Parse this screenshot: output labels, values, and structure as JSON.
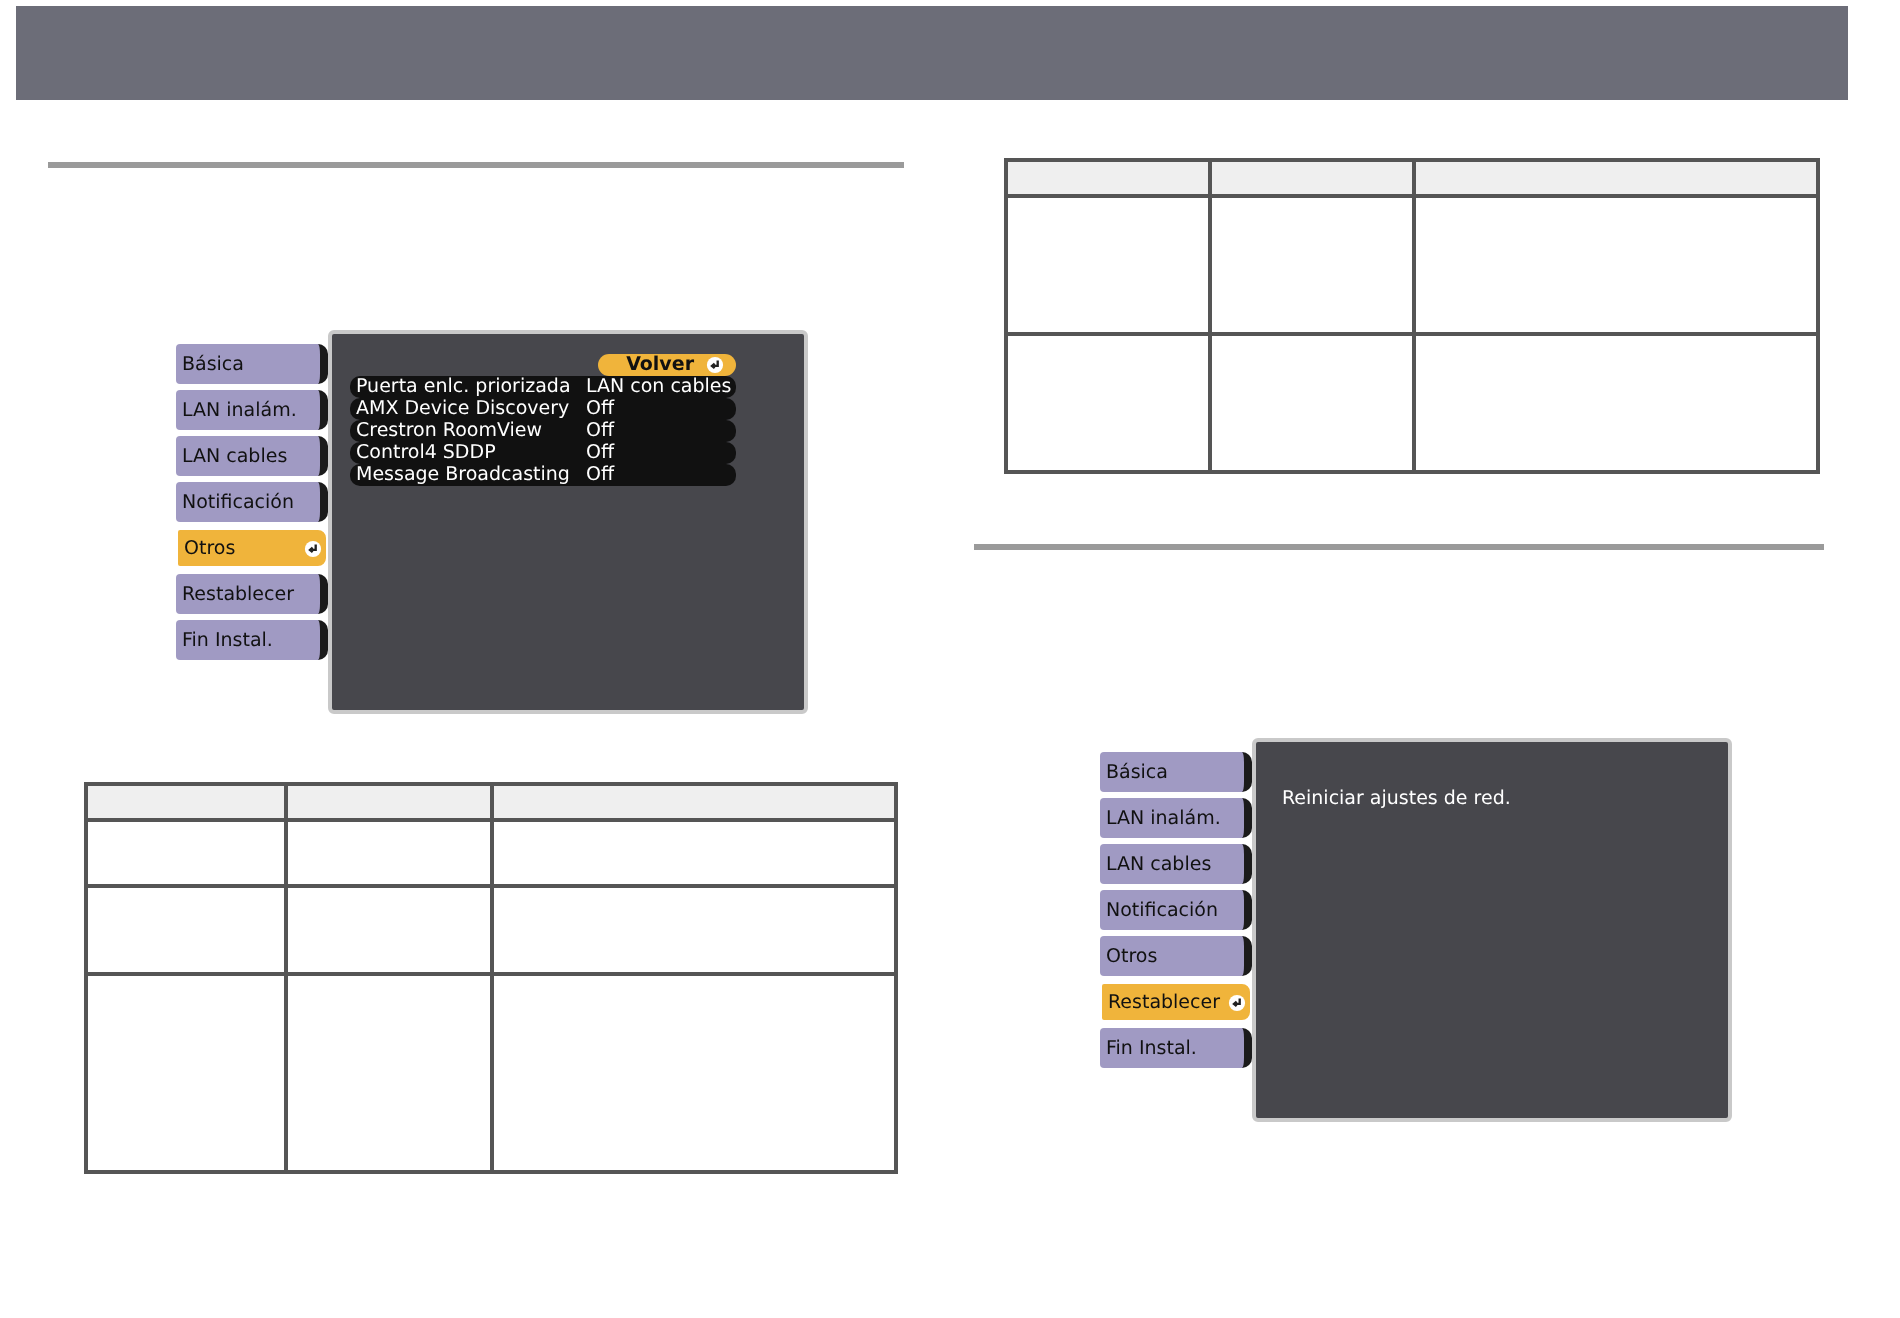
{
  "menus": [
    {
      "items": [
        {
          "label": "Básica",
          "selected": false
        },
        {
          "label": "LAN inalám.",
          "selected": false
        },
        {
          "label": "LAN cables",
          "selected": false
        },
        {
          "label": "Notificación",
          "selected": false
        },
        {
          "label": "Otros",
          "selected": true
        },
        {
          "label": "Restablecer",
          "selected": false
        },
        {
          "label": "Fin Instal.",
          "selected": false
        }
      ],
      "back_button": "Volver",
      "settings": [
        {
          "name": "Puerta enlc. priorizada",
          "value": "LAN con cables"
        },
        {
          "name": "AMX Device Discovery",
          "value": "Off"
        },
        {
          "name": "Crestron RoomView",
          "value": "Off"
        },
        {
          "name": "Control4 SDDP",
          "value": "Off"
        },
        {
          "name": "Message Broadcasting",
          "value": "Off"
        }
      ]
    },
    {
      "items": [
        {
          "label": "Básica",
          "selected": false
        },
        {
          "label": "LAN inalám.",
          "selected": false
        },
        {
          "label": "LAN cables",
          "selected": false
        },
        {
          "label": "Notificación",
          "selected": false
        },
        {
          "label": "Otros",
          "selected": false
        },
        {
          "label": "Restablecer",
          "selected": true
        },
        {
          "label": "Fin Instal.",
          "selected": false
        }
      ],
      "message": "Reiniciar ajustes de red."
    }
  ]
}
